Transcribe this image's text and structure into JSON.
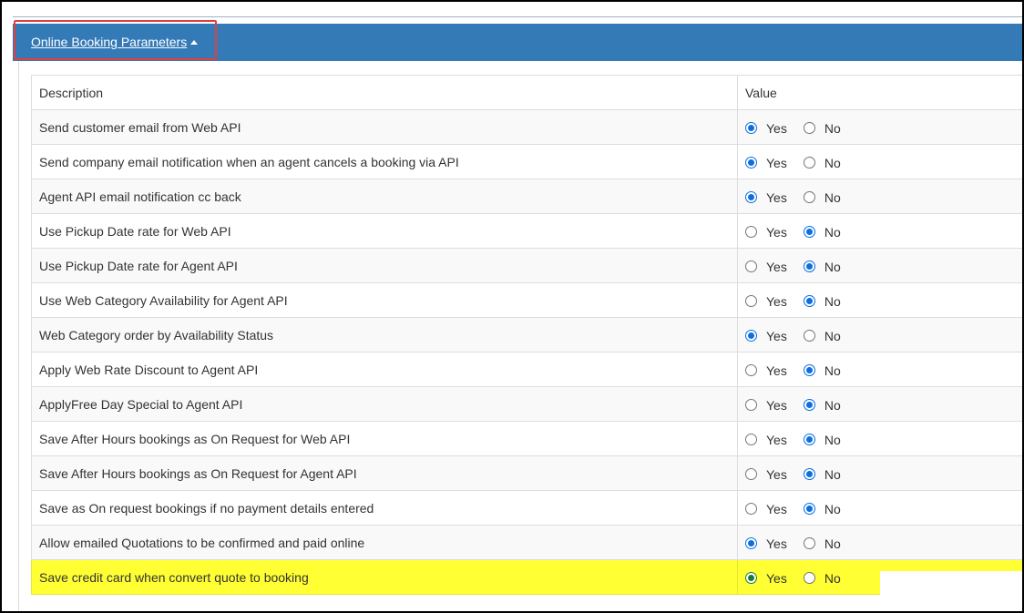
{
  "panel": {
    "title": "Online Booking Parameters"
  },
  "table": {
    "headers": {
      "description": "Description",
      "value": "Value"
    },
    "yes_label": "Yes",
    "no_label": "No",
    "rows": [
      {
        "description": "Send customer email from Web API",
        "value": "Yes"
      },
      {
        "description": "Send company email notification when an agent cancels a booking via API",
        "value": "Yes"
      },
      {
        "description": "Agent API email notification cc back",
        "value": "Yes"
      },
      {
        "description": "Use Pickup Date rate for Web API",
        "value": "No"
      },
      {
        "description": "Use Pickup Date rate for Agent API",
        "value": "No"
      },
      {
        "description": "Use Web Category Availability for Agent API",
        "value": "No"
      },
      {
        "description": "Web Category order by Availability Status",
        "value": "Yes"
      },
      {
        "description": "Apply Web Rate Discount to Agent API",
        "value": "No"
      },
      {
        "description": "ApplyFree Day Special to Agent API",
        "value": "No"
      },
      {
        "description": "Save After Hours bookings as On Request for Web API",
        "value": "No"
      },
      {
        "description": "Save After Hours bookings as On Request for Agent API",
        "value": "No"
      },
      {
        "description": "Save as On request bookings if no payment details entered",
        "value": "No"
      },
      {
        "description": "Allow emailed Quotations to be confirmed and paid online",
        "value": "Yes"
      },
      {
        "description": "Save credit card when convert quote to booking",
        "value": "Yes",
        "highlighted": true
      }
    ]
  },
  "colors": {
    "header_bg": "#337ab7",
    "highlight": "#ffff33",
    "annotation_box": "#e0403c",
    "radio_checked": "#0b6fe0"
  }
}
